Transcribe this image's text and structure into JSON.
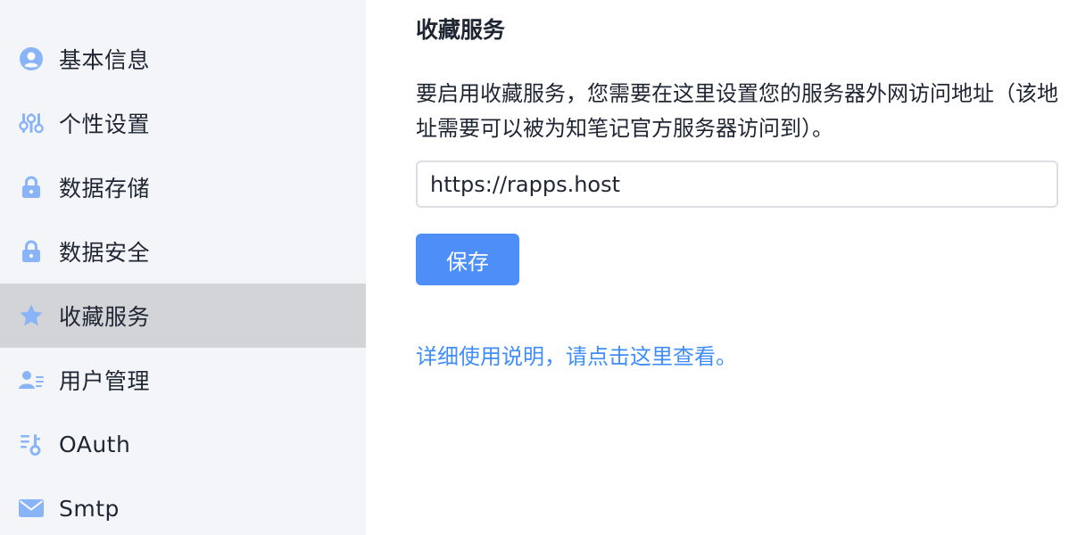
{
  "sidebar": {
    "items": [
      {
        "label": "基本信息",
        "icon": "user-circle-icon"
      },
      {
        "label": "个性设置",
        "icon": "sliders-icon"
      },
      {
        "label": "数据存储",
        "icon": "lock-icon"
      },
      {
        "label": "数据安全",
        "icon": "lock-icon"
      },
      {
        "label": "收藏服务",
        "icon": "star-icon",
        "active": true
      },
      {
        "label": "用户管理",
        "icon": "user-list-icon"
      },
      {
        "label": "OAuth",
        "icon": "key-list-icon"
      },
      {
        "label": "Smtp",
        "icon": "mail-icon"
      }
    ]
  },
  "main": {
    "title": "收藏服务",
    "description": "要启用收藏服务，您需要在这里设置您的服务器外网访问地址（该地址需要可以被为知笔记官方服务器访问到）。",
    "url_input": {
      "value": "https://rapps.host"
    },
    "save_label": "保存",
    "help_link": "详细使用说明，请点击这里查看。"
  },
  "colors": {
    "sidebar_bg": "#f4f5f9",
    "active_bg": "#d3d4d8",
    "icon": "#8ab4f8",
    "primary": "#4d8ef9",
    "link": "#3f8df8",
    "text": "#1f2633"
  }
}
